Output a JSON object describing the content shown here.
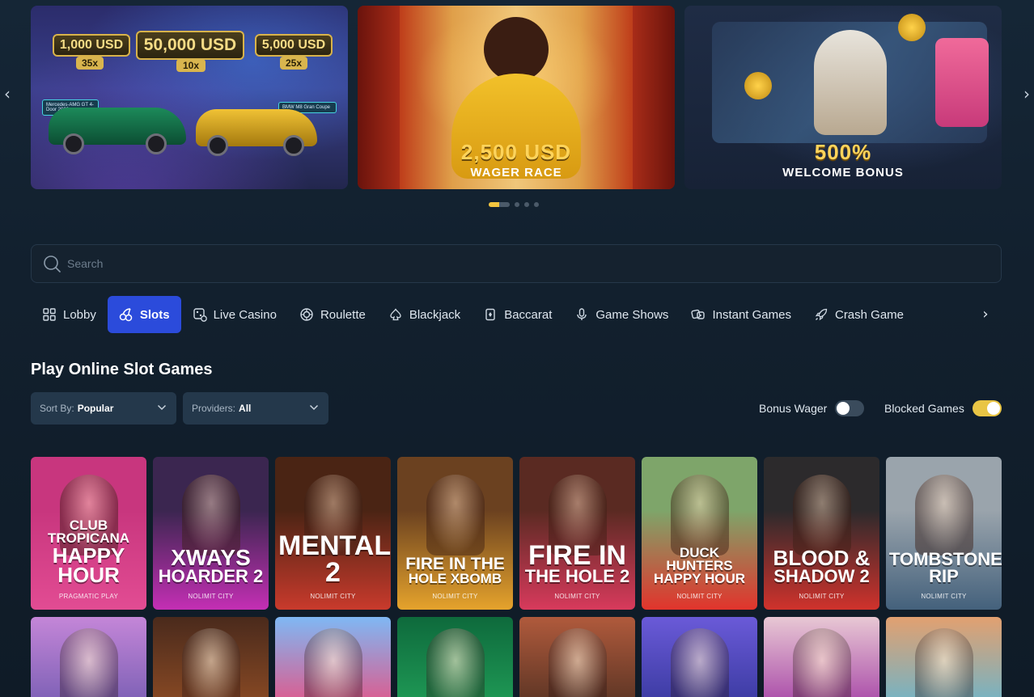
{
  "carousel": {
    "banners": [
      {
        "prizes": [
          {
            "amount": "1,000 USD",
            "multiplier": "35x"
          },
          {
            "amount": "50,000 USD",
            "multiplier": "10x"
          },
          {
            "amount": "5,000 USD",
            "multiplier": "25x"
          }
        ],
        "car_tags": [
          "Mercedes-AMG GT 4-Door 2026",
          "BMW M8 Gran Coupe"
        ]
      },
      {
        "headline": "2,500 USD",
        "subline": "WAGER RACE"
      },
      {
        "headline": "500%",
        "subline": "WELCOME BONUS"
      }
    ],
    "prev_icon": "chevron-left-icon",
    "next_icon": "chevron-right-icon",
    "page_count": 5,
    "active_page": 1
  },
  "search": {
    "placeholder": "Search",
    "value": ""
  },
  "tabs": [
    {
      "label": "Lobby",
      "icon": "grid-icon",
      "active": false
    },
    {
      "label": "Slots",
      "icon": "cherries-icon",
      "active": true
    },
    {
      "label": "Live Casino",
      "icon": "live-dice-icon",
      "active": false
    },
    {
      "label": "Roulette",
      "icon": "roulette-icon",
      "active": false
    },
    {
      "label": "Blackjack",
      "icon": "spade-icon",
      "active": false
    },
    {
      "label": "Baccarat",
      "icon": "card-icon",
      "active": false
    },
    {
      "label": "Game Shows",
      "icon": "microphone-icon",
      "active": false
    },
    {
      "label": "Instant Games",
      "icon": "dice-icon",
      "active": false
    },
    {
      "label": "Crash Game",
      "icon": "rocket-icon",
      "active": false
    }
  ],
  "section_title": "Play Online Slot Games",
  "filters": {
    "sort_label": "Sort By:",
    "sort_value": "Popular",
    "providers_label": "Providers:",
    "providers_value": "All"
  },
  "toggles": {
    "bonus_wager_label": "Bonus Wager",
    "bonus_wager_on": false,
    "blocked_games_label": "Blocked Games",
    "blocked_games_on": true
  },
  "games_row1": [
    {
      "title_line1": "CLUB TROPICANA",
      "title_line2": "HAPPY HOUR",
      "provider": "PRAGMATIC PLAY",
      "color_top": "#c8367e",
      "color_bottom": "#e24c93"
    },
    {
      "title_line1": "XWAYS",
      "title_line2": "HOARDER 2",
      "provider": "NOLIMIT CITY",
      "color_top": "#3b2650",
      "color_bottom": "#c42fb4"
    },
    {
      "title_line1": "MENTAL 2",
      "title_line2": "",
      "provider": "NOLIMIT CITY",
      "color_top": "#4a2414",
      "color_bottom": "#c93a2c"
    },
    {
      "title_line1": "FIRE IN THE",
      "title_line2": "HOLE XBOMB",
      "provider": "NOLIMIT CITY",
      "color_top": "#6b4120",
      "color_bottom": "#e5a32c"
    },
    {
      "title_line1": "FIRE IN",
      "title_line2": "THE HOLE 2",
      "provider": "NOLIMIT CITY",
      "color_top": "#5a2a22",
      "color_bottom": "#d83a5c"
    },
    {
      "title_line1": "DUCK HUNTERS",
      "title_line2": "HAPPY HOUR",
      "provider": "NOLIMIT CITY",
      "color_top": "#7ea56a",
      "color_bottom": "#e2342c"
    },
    {
      "title_line1": "BLOOD &",
      "title_line2": "SHADOW 2",
      "provider": "NOLIMIT CITY",
      "color_top": "#2c2a2c",
      "color_bottom": "#d0322c"
    },
    {
      "title_line1": "TOMBSTONE RIP",
      "title_line2": "",
      "provider": "NOLIMIT CITY",
      "color_top": "#9aa4ac",
      "color_bottom": "#44617c"
    }
  ],
  "games_row2": [
    {
      "name": "zeus-game",
      "color_top": "#c486d8",
      "color_bottom": "#7a5fb4"
    },
    {
      "name": "golden-cross-game",
      "color_top": "#4a2a1c",
      "color_bottom": "#8a4a24"
    },
    {
      "name": "sweet-heart-game",
      "color_top": "#7fb8f4",
      "color_bottom": "#e0588a"
    },
    {
      "name": "panda-game",
      "color_top": "#0e6a3c",
      "color_bottom": "#1f9a56"
    },
    {
      "name": "viking-game",
      "color_top": "#b05a3c",
      "color_bottom": "#5a3424"
    },
    {
      "name": "zeus-lightning-game",
      "color_top": "#6a5ad8",
      "color_bottom": "#3a3aa0"
    },
    {
      "name": "buffalo-game",
      "color_top": "#e8c8d4",
      "color_bottom": "#a848a8"
    },
    {
      "name": "big-bass-cowboy-game",
      "color_top": "#e2a070",
      "color_bottom": "#6fb4c8"
    }
  ]
}
